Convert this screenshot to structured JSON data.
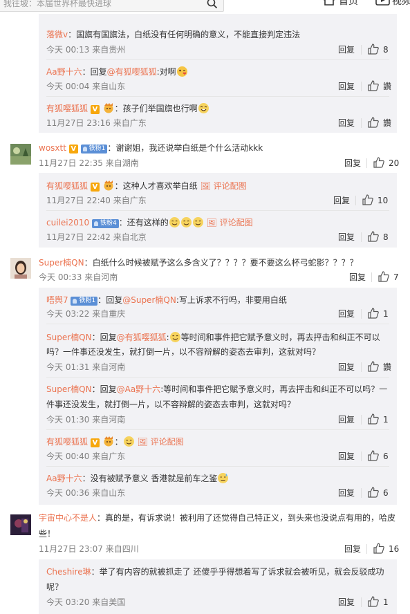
{
  "header": {
    "search_placeholder": "我往坡：本届世界杯最快进球",
    "nav_home": "首页",
    "nav_video": "视频"
  },
  "labels": {
    "reply": "回复",
    "like_text": "讚",
    "reply_prefix": "：回复",
    "comment_pic": "评论配图"
  },
  "threads": [
    {
      "subs": [
        {
          "user": "落微v",
          "text": "：国旗有国旗法，白纸没有任何明确的意义，不能直接判定违法",
          "time": "今天 00:13 来自贵州",
          "likes": "8"
        },
        {
          "user": "Aa野十六",
          "prefix": "：回复",
          "mention": "@有狐嘤狐狐",
          "text": ":对啊",
          "time": "今天 00:04 来自山东",
          "likes": "讚"
        },
        {
          "user": "有狐嘤狐狐",
          "text": "：孩子们举国旗也行啊",
          "time": "11月27日 23:16 来自广东",
          "likes": "讚"
        }
      ]
    },
    {
      "user": "wosxtt",
      "tag": "铁粉1",
      "text": "：谢谢姐，我还说举白纸是个什么活动kkk",
      "time": "11月27日 22:35 来自湖南",
      "likes": "20",
      "subs": [
        {
          "user": "有狐嘤狐狐",
          "text": "：这种人才喜欢举白纸",
          "time": "11月27日 22:40 来自广东",
          "likes": "10"
        },
        {
          "user": "cuilei2010",
          "tag": "铁粉4",
          "text": "：还有这样的",
          "time": "11月27日 22:42 来自北京",
          "likes": "8"
        }
      ]
    },
    {
      "user": "Super楠QN",
      "text": "：白纸什么时候被赋予这么多含义了？？？？要不要这么杯弓蛇影？？？？",
      "time": "今天 00:33 来自河南",
      "likes": "7",
      "subs": [
        {
          "user": "唔舆7",
          "tag": "铁粉1",
          "prefix": "：回复",
          "mention": "@Super楠QN",
          "text": ":写上诉求不行吗，非要用白纸",
          "time": "今天 03:22 来自重庆",
          "likes": "1"
        },
        {
          "user": "Super楠QN",
          "prefix": "：回复",
          "mention": "@有狐嘤狐狐",
          "text": ":",
          "text2": "等时间和事件把它赋予意义时，再去抨击和纠正不可以",
          "line2": "吗？一件事还没发生，就打倒一片，以不容辩解的姿态去审判，这就对吗？",
          "time": "今天 01:31 来自河南",
          "likes": "讚"
        },
        {
          "user": "Super楠QN",
          "prefix": "：回复",
          "mention": "@Aa野十六",
          "text": ":等时间和事件把它赋予意义时，再去抨击和纠正不可以吗？一",
          "line2": "件事还没发生，就打倒一片，以不容辩解的姿态去审判，这就对吗？",
          "time": "今天 01:30 来自河南",
          "likes": "1"
        },
        {
          "user": "有狐嘤狐狐",
          "text": "：",
          "time": "今天 00:40 来自广东",
          "likes": "6"
        },
        {
          "user": "Aa野十六",
          "text": "：没有被赋予意义 香港就是前车之鉴",
          "time": "今天 00:36 来自山东",
          "likes": "6"
        }
      ]
    },
    {
      "user": "宇宙中心不是人",
      "text": "：真的是，有诉求说！被利用了还觉得自己特正义，到头来也没说点有用的，哈皮",
      "line2": "些！",
      "time": "11月27日 23:07 来自四川",
      "likes": "16",
      "subs": [
        {
          "user": "Cheshire琳",
          "text": "：举了有内容的就被抓走了 还傻乎乎得想着写了诉求就会被听见，就会反驳成功",
          "line2": "呢？",
          "time": "今天 03:20 来自美国",
          "likes": "1"
        }
      ]
    }
  ]
}
